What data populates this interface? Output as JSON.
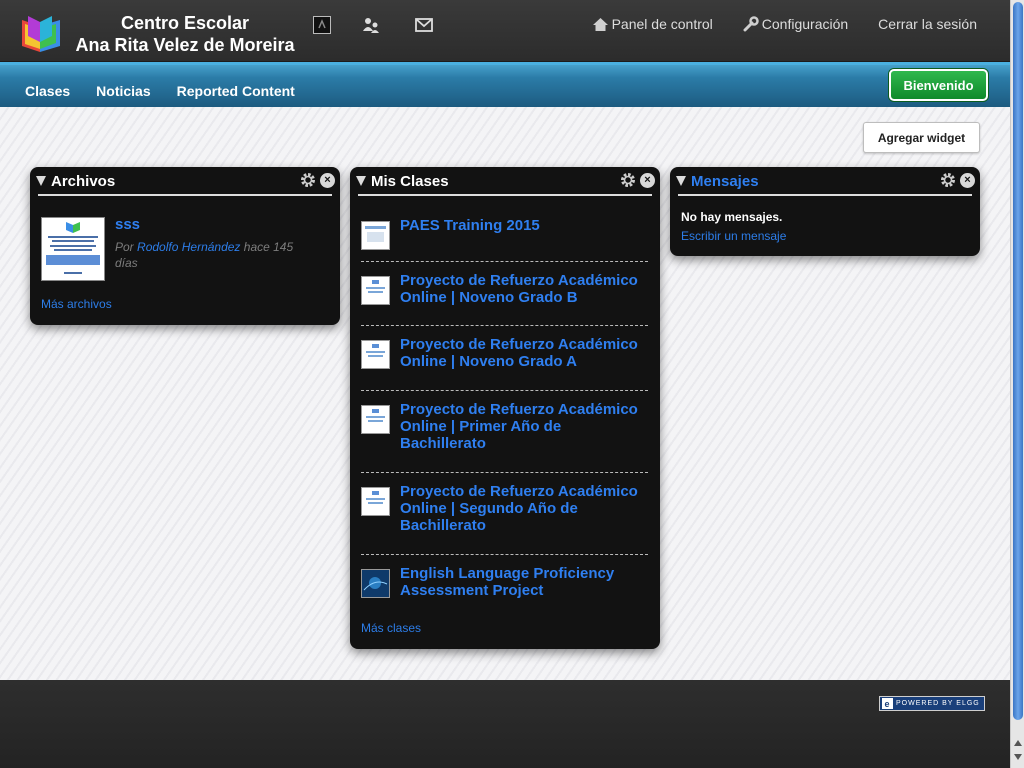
{
  "header": {
    "site_title_line1": "Centro Escolar",
    "site_title_line2": "Ana Rita Velez de Moreira",
    "top_links": {
      "dashboard": "Panel de control",
      "settings": "Configuración",
      "logout": "Cerrar la sesión"
    },
    "icons": [
      "elgg-logo-icon",
      "friends-icon",
      "mail-icon"
    ]
  },
  "nav": {
    "items": [
      "Clases",
      "Noticias",
      "Reported Content"
    ],
    "welcome_button": "Bienvenido"
  },
  "main": {
    "add_widget_label": "Agregar widget",
    "widgets": {
      "files": {
        "title": "Archivos",
        "item": {
          "title": "sss",
          "by_label": "Por",
          "author": "Rodolfo Hernández",
          "time": "hace 145 días"
        },
        "more_link": "Más archivos"
      },
      "classes": {
        "title": "Mis Clases",
        "items": [
          "PAES Training 2015",
          "Proyecto de Refuerzo Académico Online | Noveno Grado B",
          "Proyecto de Refuerzo Académico Online | Noveno Grado A",
          "Proyecto de Refuerzo Académico Online | Primer Año de Bachillerato",
          "Proyecto de Refuerzo Académico Online | Segundo Año de Bachillerato",
          "English Language Proficiency Assessment Project"
        ],
        "more_link": "Más clases"
      },
      "messages": {
        "title": "Mensajes",
        "empty_text": "No hay mensajes.",
        "write_link": "Escribir un mensaje"
      }
    }
  },
  "footer": {
    "powered_by": "POWERED BY ELGG"
  },
  "colors": {
    "nav_blue": "#2b7ca8",
    "welcome_green": "#16a036",
    "link_blue": "#2f7ff0",
    "widget_bg": "#121212"
  }
}
